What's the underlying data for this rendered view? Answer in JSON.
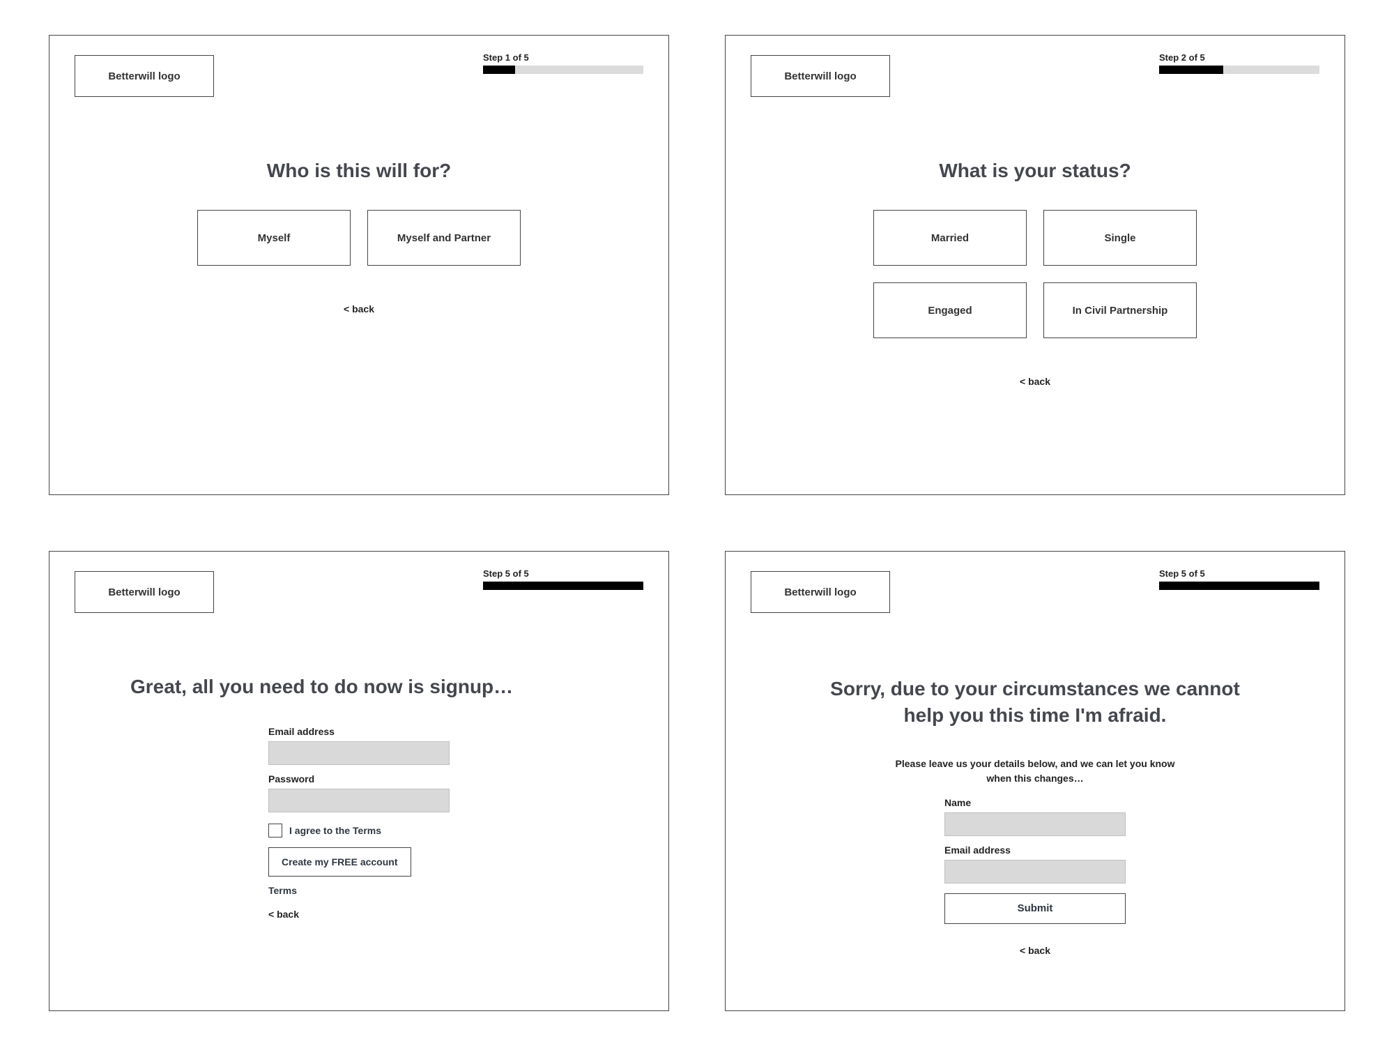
{
  "logo_text": "Betterwill logo",
  "back_label": "< back",
  "panels": {
    "p1": {
      "step_label": "Step 1 of 5",
      "progress_pct": 20,
      "title": "Who is this will for?",
      "options": [
        "Myself",
        "Myself and Partner"
      ]
    },
    "p2": {
      "step_label": "Step 2 of 5",
      "progress_pct": 40,
      "title": "What is your status?",
      "options_row1": [
        "Married",
        "Single"
      ],
      "options_row2": [
        "Engaged",
        "In Civil Partnership"
      ]
    },
    "p3": {
      "step_label": "Step 5 of 5",
      "progress_pct": 100,
      "title": "Great, all you need to do now is signup…",
      "email_label": "Email address",
      "password_label": "Password",
      "agree_label": "I agree to the Terms",
      "create_btn": "Create my FREE account",
      "terms_link": "Terms"
    },
    "p4": {
      "step_label": "Step 5 of 5",
      "progress_pct": 100,
      "title": "Sorry, due to your circumstances we cannot help you this time I'm afraid.",
      "subcopy": "Please leave us your details below, and we can let you know when this changes…",
      "name_label": "Name",
      "email_label": "Email address",
      "submit_label": "Submit"
    }
  }
}
